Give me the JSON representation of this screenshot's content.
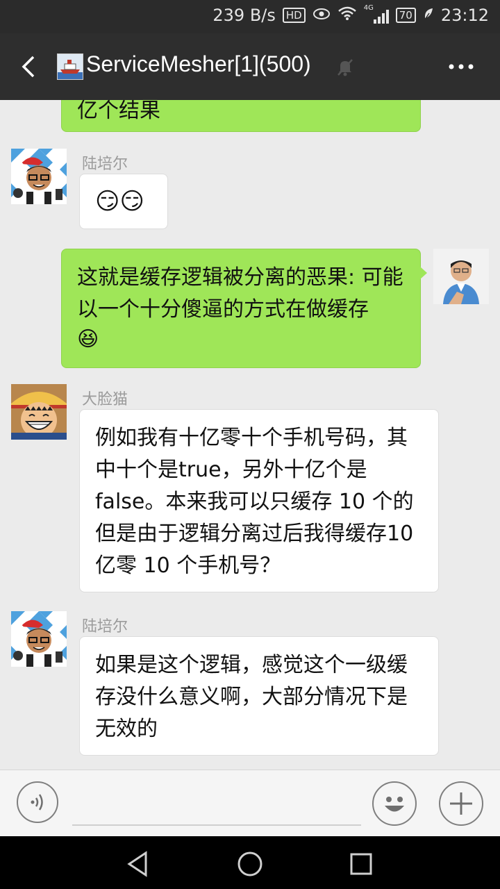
{
  "status_bar": {
    "net_speed": "239 B/s",
    "hd_label": "HD",
    "network_label": "4G",
    "battery": "70",
    "time": "23:12"
  },
  "header": {
    "title": "ServiceMesher[1](500)"
  },
  "messages": [
    {
      "side": "right",
      "type": "text",
      "text": "亿个结果"
    },
    {
      "side": "left",
      "sender": "陆培尔",
      "type": "emoji",
      "emoji": "😏😏"
    },
    {
      "side": "right",
      "type": "text",
      "text": "这就是缓存逻辑被分离的恶果: 可能以一个十分傻逼的方式在做缓存",
      "emoji": "😆"
    },
    {
      "side": "left",
      "sender": "大脸猫",
      "type": "text",
      "text": "例如我有十亿零十个手机号码，其中十个是true，另外十亿个是false。本来我可以只缓存 10 个的但是由于逻辑分离过后我得缓存10亿零 10 个手机号？"
    },
    {
      "side": "left",
      "sender": "陆培尔",
      "type": "text",
      "text": "如果是这个逻辑，感觉这个一级缓存没什么意义啊，大部分情况下是无效的"
    }
  ],
  "colors": {
    "green_bubble": "#9fe658",
    "white_bubble": "#ffffff",
    "background": "#ebebeb",
    "header": "#2e2e2e"
  }
}
